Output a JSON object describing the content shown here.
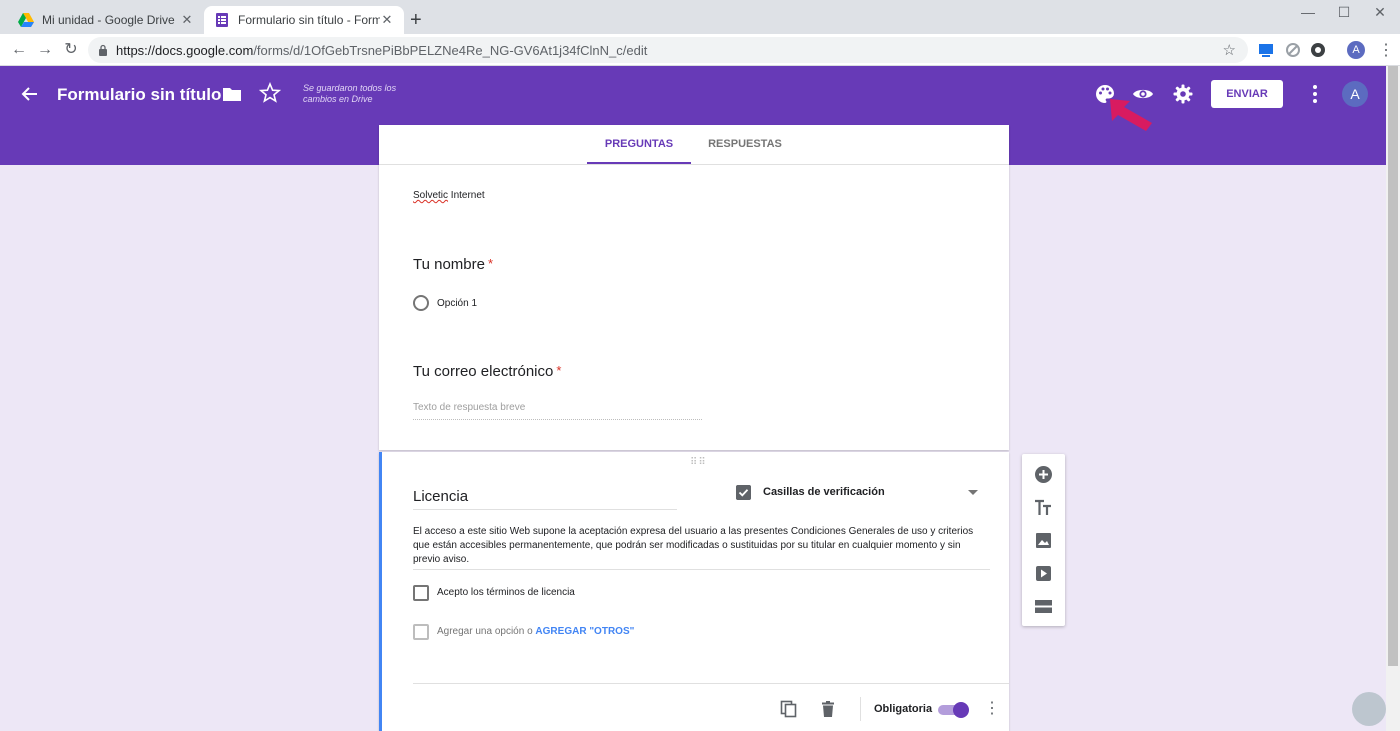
{
  "browser": {
    "tabs": [
      {
        "title": "Mi unidad - Google Drive",
        "icon": "google-drive-icon"
      },
      {
        "title": "Formulario sin título - Formulario",
        "icon": "google-forms-icon"
      }
    ],
    "url_host": "https://docs.google.com",
    "url_path": "/forms/d/1OfGebTrsnePiBbPELZNe4Re_NG-GV6At1j34fClnN_c/edit",
    "profile_initial": "A"
  },
  "header": {
    "title": "Formulario sin título",
    "saved_status": "Se guardaron todos los cambios en Drive",
    "send_label": "ENVIAR",
    "avatar_initial": "A",
    "bg_color": "#673ab7"
  },
  "tabs": {
    "questions": "PREGUNTAS",
    "responses": "RESPUESTAS"
  },
  "form": {
    "description_word1": "Solvetic",
    "description_word2": "Internet",
    "questions": [
      {
        "title": "Tu nombre",
        "required": "*",
        "options": [
          "Opción 1"
        ]
      },
      {
        "title": "Tu correo electrónico",
        "required": "*",
        "placeholder": "Texto de respuesta breve"
      }
    ]
  },
  "active_question": {
    "title": "Licencia",
    "type": "Casillas de verificación",
    "description": "El acceso a este sitio Web supone la aceptación expresa del usuario a las presentes Condiciones Generales de uso y criterios que están accesibles permanentemente, que podrán ser modificadas o sustituidas por su titular en cualquier momento y sin previo aviso.",
    "options": [
      "Acepto los términos de licencia"
    ],
    "add_option": "Agregar una opción",
    "or": "o",
    "add_other": "AGREGAR \"OTROS\"",
    "required_label": "Obligatoria",
    "required_on": true
  },
  "side_toolbar": [
    "add-question-icon",
    "add-title-icon",
    "add-image-icon",
    "add-video-icon",
    "add-section-icon"
  ],
  "colors": {
    "accent": "#673ab7",
    "background": "#ede7f6",
    "required": "#d93025",
    "active_border": "#4285f4",
    "annotation_arrow": "#d81b60"
  }
}
